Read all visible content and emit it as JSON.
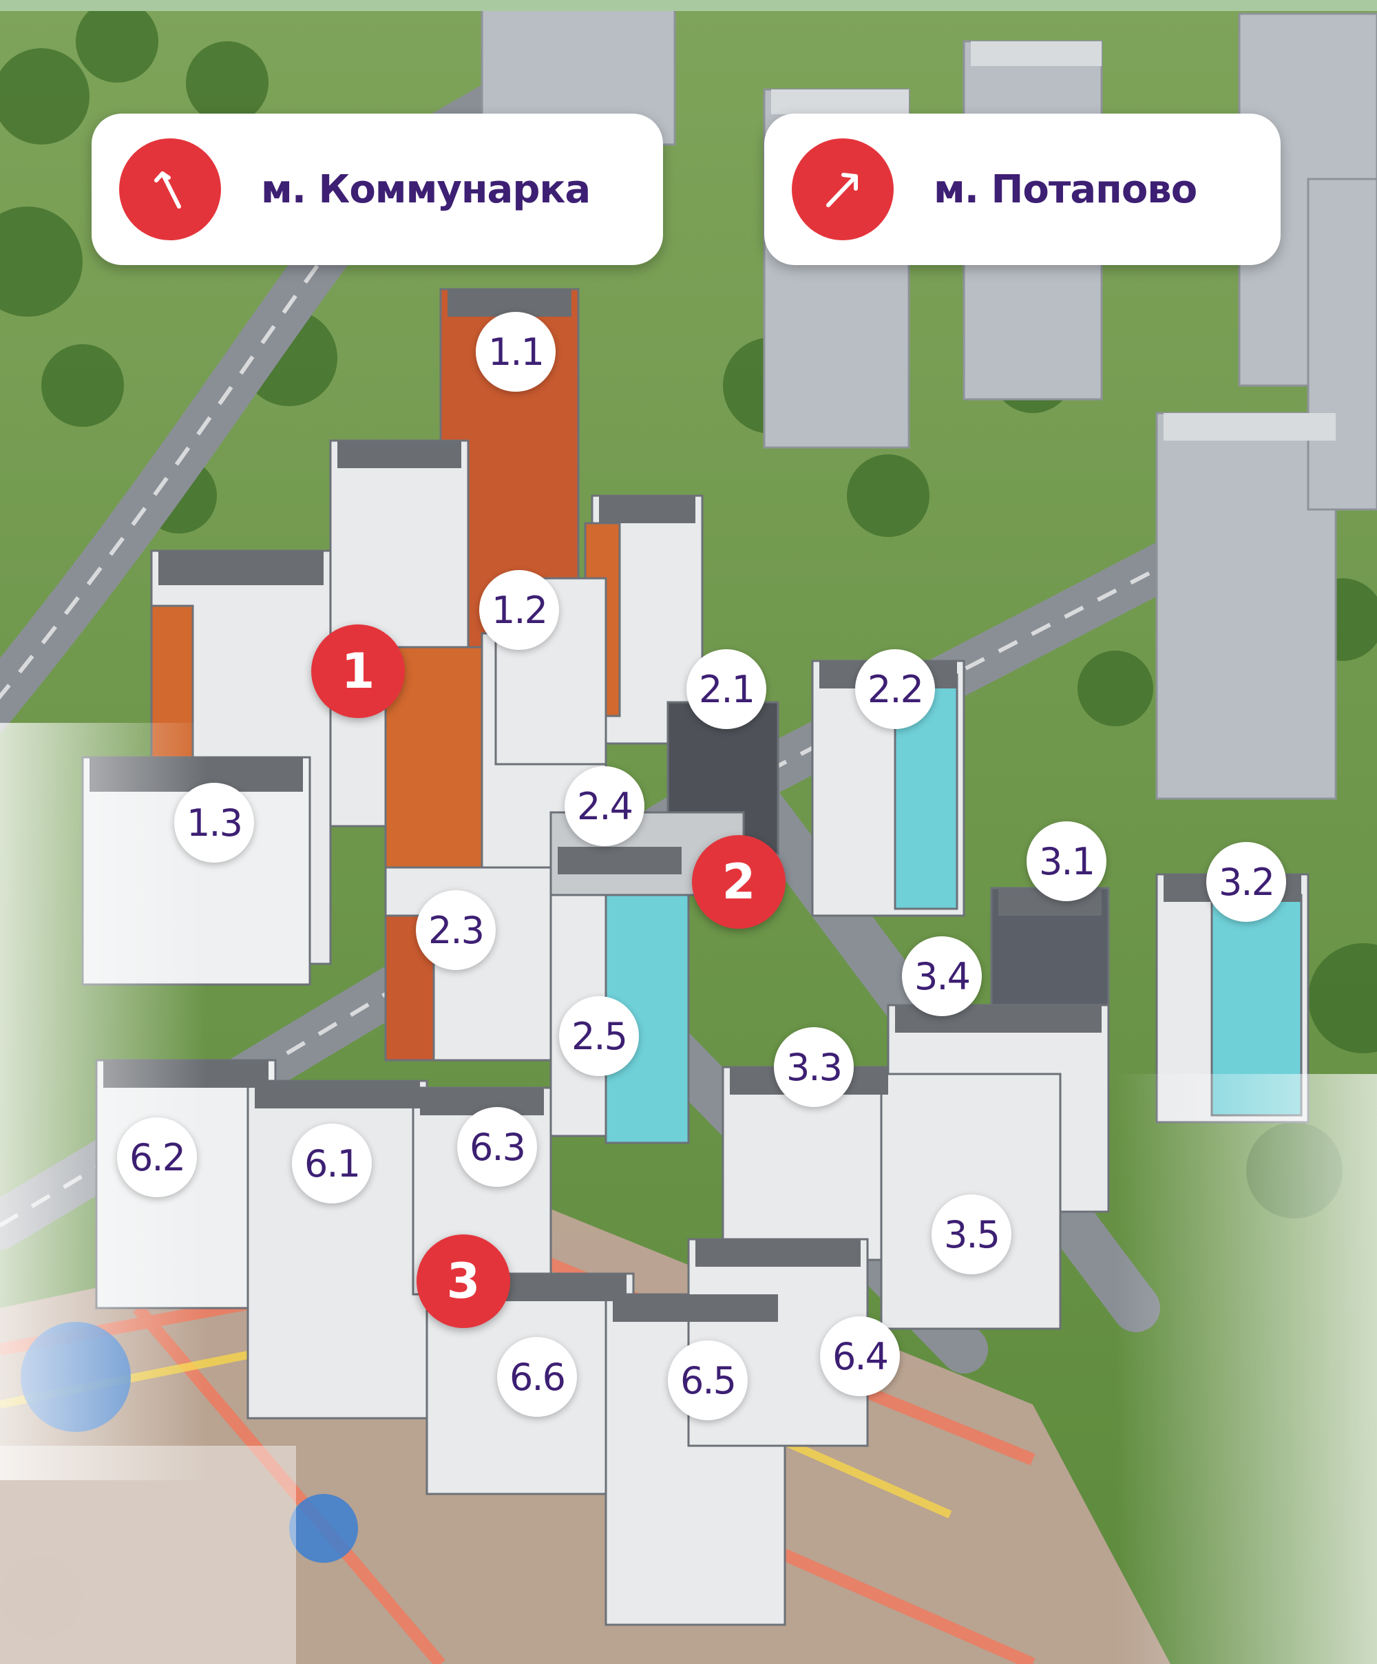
{
  "metro": [
    {
      "label": "м. Коммунарка",
      "icon": "arrow-up-left-icon"
    },
    {
      "label": "м. Потапово",
      "icon": "arrow-up-right-icon"
    }
  ],
  "stages": [
    "1",
    "2",
    "3"
  ],
  "buildings": [
    "1.1",
    "1.2",
    "1.3",
    "2.1",
    "2.2",
    "2.3",
    "2.4",
    "2.5",
    "3.1",
    "3.2",
    "3.3",
    "3.4",
    "3.5",
    "6.1",
    "6.2",
    "6.3",
    "6.4",
    "6.5",
    "6.6"
  ],
  "colors": {
    "accent_red": "#e4343b",
    "label_purple": "#3d1f73",
    "frame_green": "#a9c9a0"
  }
}
